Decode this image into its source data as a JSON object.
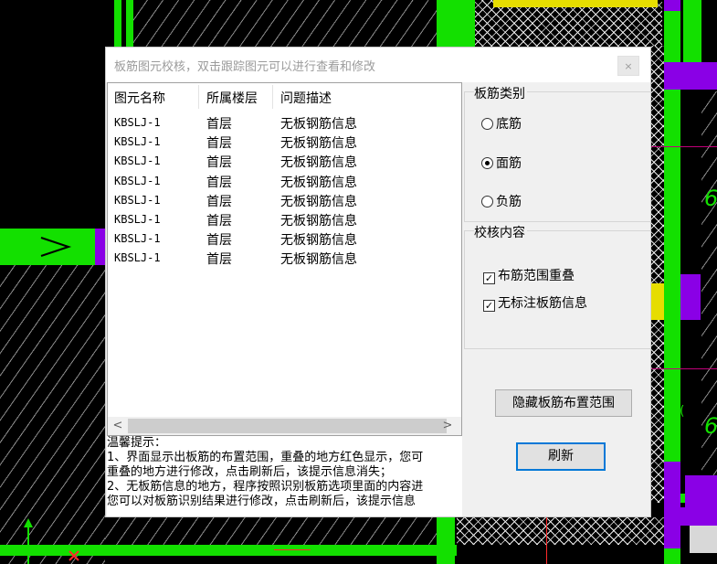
{
  "window": {
    "title": "板筋图元校核，双击跟踪图元可以进行查看和修改",
    "close_label": "×"
  },
  "list": {
    "columns": [
      "图元名称",
      "所属楼层",
      "问题描述"
    ],
    "rows": [
      [
        "KBSLJ-1",
        "首层",
        "无板钢筋信息"
      ],
      [
        "KBSLJ-1",
        "首层",
        "无板钢筋信息"
      ],
      [
        "KBSLJ-1",
        "首层",
        "无板钢筋信息"
      ],
      [
        "KBSLJ-1",
        "首层",
        "无板钢筋信息"
      ],
      [
        "KBSLJ-1",
        "首层",
        "无板钢筋信息"
      ],
      [
        "KBSLJ-1",
        "首层",
        "无板钢筋信息"
      ],
      [
        "KBSLJ-1",
        "首层",
        "无板钢筋信息"
      ],
      [
        "KBSLJ-1",
        "首层",
        "无板钢筋信息"
      ]
    ],
    "scroll_left": "<",
    "scroll_right": ">"
  },
  "tips": {
    "lines": [
      "温馨提示：",
      "1、界面显示出板筋的布置范围，重叠的地方红色显示，您可",
      "重叠的地方进行修改，点击刷新后，该提示信息消失；",
      "2、无板筋信息的地方，程序按照识别板筋选项里面的内容进",
      "您可以对板筋识别结果进行修改，点击刷新后，该提示信息"
    ]
  },
  "rebar_type": {
    "title": "板筋类别",
    "options": [
      {
        "label": "底筋",
        "selected": false
      },
      {
        "label": "面筋",
        "selected": true
      },
      {
        "label": "负筋",
        "selected": false
      }
    ]
  },
  "check_content": {
    "title": "校核内容",
    "items": [
      {
        "label": "布筋范围重叠",
        "checked": true,
        "mark": "✓"
      },
      {
        "label": "无标注板筋信息",
        "checked": true,
        "mark": "✓"
      }
    ]
  },
  "buttons": {
    "hide_range": "隐藏板筋布置范围",
    "refresh": "刷新"
  },
  "cad": {
    "label_a": "(",
    "label_b": "6",
    "label_c": "6",
    "label_d": "6"
  }
}
